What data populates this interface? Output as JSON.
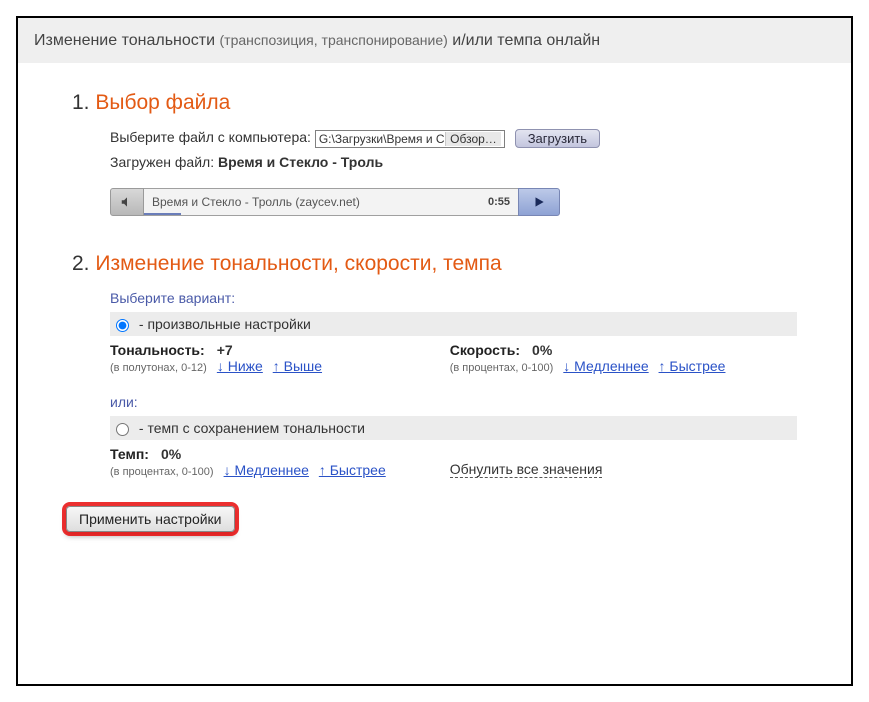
{
  "header": {
    "title_main": "Изменение тональности",
    "title_sub": "(транспозиция, транспонирование)",
    "title_tail": "и/или темпа онлайн"
  },
  "section1": {
    "num": "1.",
    "title": "Выбор файла",
    "choose_label": "Выберите файл с компьютера:",
    "file_path": "G:\\Загрузки\\Время и С",
    "browse_label": "Обзор…",
    "upload_label": "Загрузить",
    "uploaded_prefix": "Загружен файл:",
    "uploaded_name": "Время и Стекло - Троль",
    "player": {
      "track_title": "Время и Стекло - Тролль (zaycev.net)",
      "time": "0:55"
    }
  },
  "section2": {
    "num": "2.",
    "title": "Изменение тональности, скорости, темпа",
    "variant_label": "Выберите вариант:",
    "radio_arbitrary": "- произвольные настройки",
    "tonality": {
      "label": "Тональность:",
      "value": "+7",
      "hint": "(в полутонах, 0-12)",
      "lower": "↓ Ниже",
      "higher": "↑ Выше"
    },
    "speed": {
      "label": "Скорость:",
      "value": "0%",
      "hint": "(в процентах, 0-100)",
      "slower": "↓ Медленнее",
      "faster": "↑ Быстрее"
    },
    "or_label": "или:",
    "radio_tempo": "- темп с сохранением тональности",
    "tempo": {
      "label": "Темп:",
      "value": "0%",
      "hint": "(в процентах, 0-100)",
      "slower": "↓ Медленнее",
      "faster": "↑ Быстрее"
    },
    "reset_label": "Обнулить все значения"
  },
  "apply_label": "Применить настройки"
}
